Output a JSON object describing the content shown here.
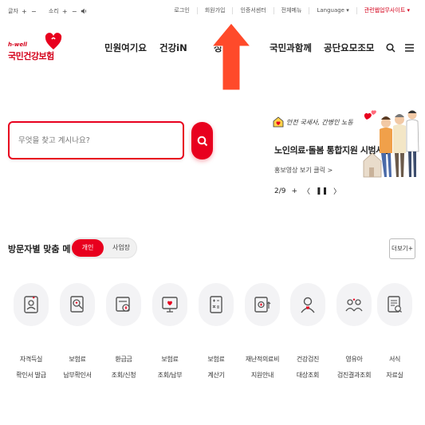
{
  "utilbar": {
    "font_label": "글자",
    "font_plus": "+",
    "font_minus": "−",
    "sound_label": "소리",
    "sound_plus": "+",
    "sound_minus": "−",
    "sound_icon": "speaker-icon",
    "links": [
      "로그인",
      "회원가입",
      "인증서센터",
      "전체메뉴"
    ],
    "language": "Language ▾",
    "sister_site": "관련웹업무사이트 ▾"
  },
  "header": {
    "brand_small": "h-well",
    "brand_name": "국민건강보험",
    "nav": [
      "민원여기요",
      "건강iN",
      "정",
      "국민과함께",
      "공단요모조모"
    ],
    "search_icon": "search-icon",
    "menu_icon": "hamburger-menu-icon"
  },
  "overlay": {
    "arrow_color": "#ff4a2a"
  },
  "search": {
    "placeholder": "무엇을 찾고 계시나요?"
  },
  "promo": {
    "slogan": "안전 국세사, 간병인 노동",
    "title": "노인의료·돌봄 통합지원 시범사업",
    "sub": "홍보영상 보기 클릭 >",
    "page": "2/9",
    "plus": "+",
    "prev": "〈",
    "pause": "❚❚",
    "next": "〉"
  },
  "visitor_menu": {
    "title": "방문자별 맞춤 메뉴",
    "tab_personal": "개인",
    "tab_business": "사업장",
    "more": "더보기+",
    "items": [
      {
        "line1": "자격득실",
        "line2": "확인서 발급",
        "icon": "id-card-icon"
      },
      {
        "line1": "보험료",
        "line2": "납부확인서",
        "icon": "payment-receipt-icon"
      },
      {
        "line1": "환급금",
        "line2": "조회/신청",
        "icon": "refund-icon"
      },
      {
        "line1": "보험료",
        "line2": "조회/납부",
        "icon": "monitor-payment-icon"
      },
      {
        "line1": "보험료",
        "line2": "계산기",
        "icon": "calculator-icon"
      },
      {
        "line1": "재난적의료비",
        "line2": "지원안내",
        "icon": "medical-support-icon"
      },
      {
        "line1": "건강검진",
        "line2": "대상조회",
        "icon": "health-checkup-icon"
      },
      {
        "line1": "영유아",
        "line2": "검진결과조회",
        "icon": "infant-checkup-icon"
      },
      {
        "line1": "서식",
        "line2": "자료실",
        "icon": "document-forms-icon"
      }
    ]
  },
  "colors": {
    "brand_red": "#e8001e",
    "text_dark": "#222222",
    "icon_bg": "#f3f3f5"
  }
}
